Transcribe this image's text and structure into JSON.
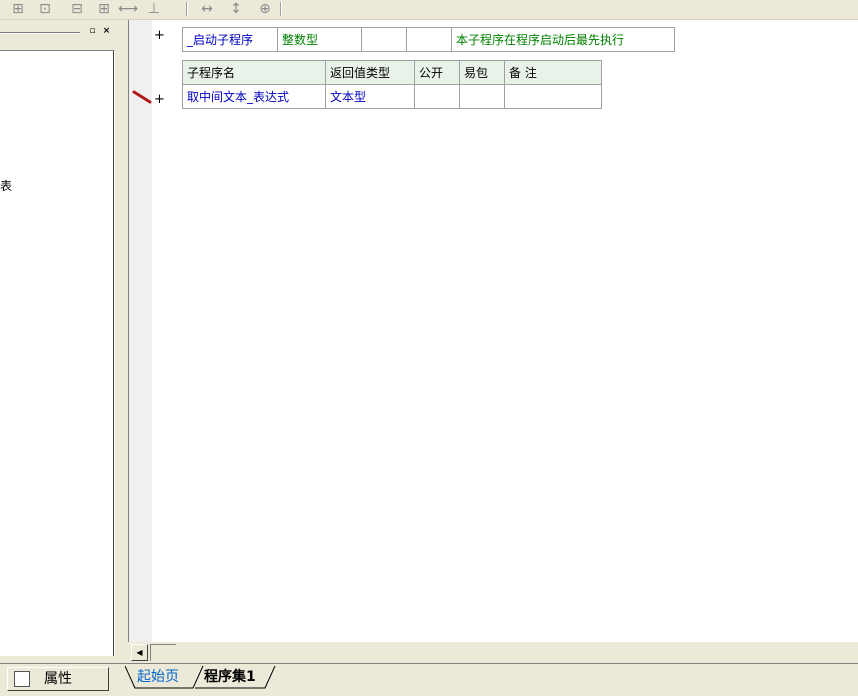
{
  "toolbar": {
    "icons": [
      "table-cell-icon",
      "table-merge-icon",
      "table-split-icon",
      "table-insert-col-icon",
      "col-width-icon",
      "row-height-icon",
      "h-expand-icon",
      "v-expand-icon",
      "table-expand-icon"
    ]
  },
  "left_panel": {
    "fragment": "表"
  },
  "editor": {
    "program_row": {
      "plus": "+",
      "name": "_启动子程序",
      "type": "整数型",
      "note": "本子程序在程序启动后最先执行"
    },
    "headers": [
      "子程序名",
      "返回值类型",
      "公开",
      "易包",
      "备 注"
    ],
    "sub_row": {
      "plus": "+",
      "name": "取中间文本_表达式",
      "type": "文本型",
      "public": "",
      "easy": "",
      "note": ""
    }
  },
  "bottom": {
    "properties_tab": "属性",
    "tab_start": "起始页",
    "tab_active": "程序集1"
  }
}
